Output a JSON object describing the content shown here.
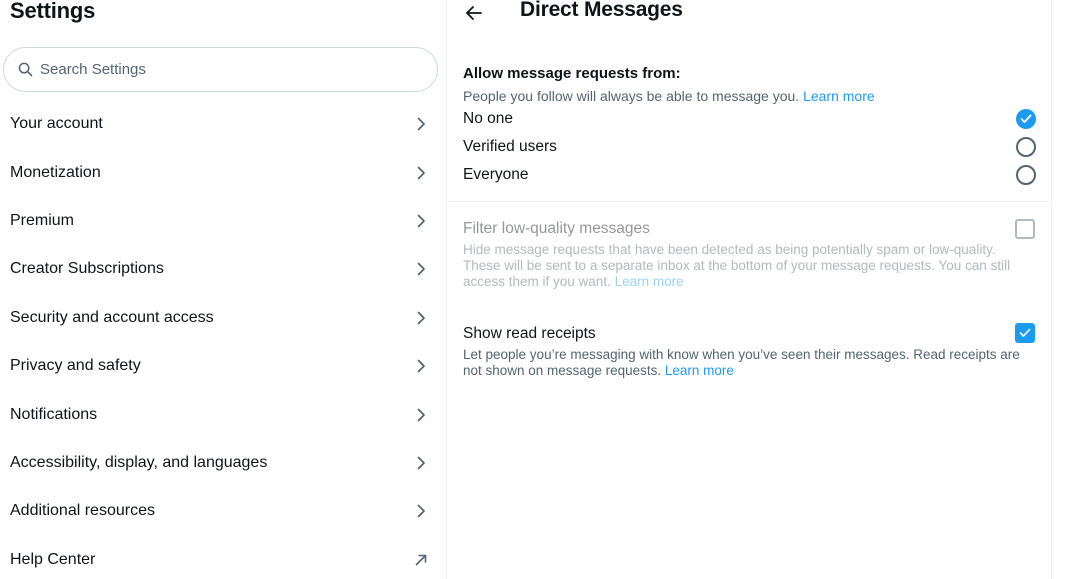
{
  "sidebar": {
    "title": "Settings",
    "search_placeholder": "Search Settings",
    "items": [
      {
        "label": "Your account",
        "icon": "chevron-right-icon"
      },
      {
        "label": "Monetization",
        "icon": "chevron-right-icon"
      },
      {
        "label": "Premium",
        "icon": "chevron-right-icon"
      },
      {
        "label": "Creator Subscriptions",
        "icon": "chevron-right-icon"
      },
      {
        "label": "Security and account access",
        "icon": "chevron-right-icon"
      },
      {
        "label": "Privacy and safety",
        "icon": "chevron-right-icon"
      },
      {
        "label": "Notifications",
        "icon": "chevron-right-icon"
      },
      {
        "label": "Accessibility, display, and languages",
        "icon": "chevron-right-icon"
      },
      {
        "label": "Additional resources",
        "icon": "chevron-right-icon"
      },
      {
        "label": "Help Center",
        "icon": "external-link-arrow-icon"
      }
    ]
  },
  "panel": {
    "title": "Direct Messages",
    "allow_heading": "Allow message requests from:",
    "allow_sub": "People you follow will always be able to message you.",
    "learn_more": "Learn more",
    "options": [
      {
        "label": "No one",
        "selected": true
      },
      {
        "label": "Verified users",
        "selected": false
      },
      {
        "label": "Everyone",
        "selected": false
      }
    ],
    "filter": {
      "title": "Filter low-quality messages",
      "desc": "Hide message requests that have been detected as being potentially spam or low-quality. These will be sent to a separate inbox at the bottom of your message requests. You can still access them if you want.",
      "checked": false,
      "disabled": true
    },
    "receipts": {
      "title": "Show read receipts",
      "desc": "Let people you’re messaging with know when you’ve seen their messages. Read receipts are not shown on message requests.",
      "checked": true
    }
  },
  "colors": {
    "accent": "#1d9bf0",
    "text_primary": "#0f1419",
    "text_secondary": "#536471",
    "border": "#cfd9de"
  }
}
